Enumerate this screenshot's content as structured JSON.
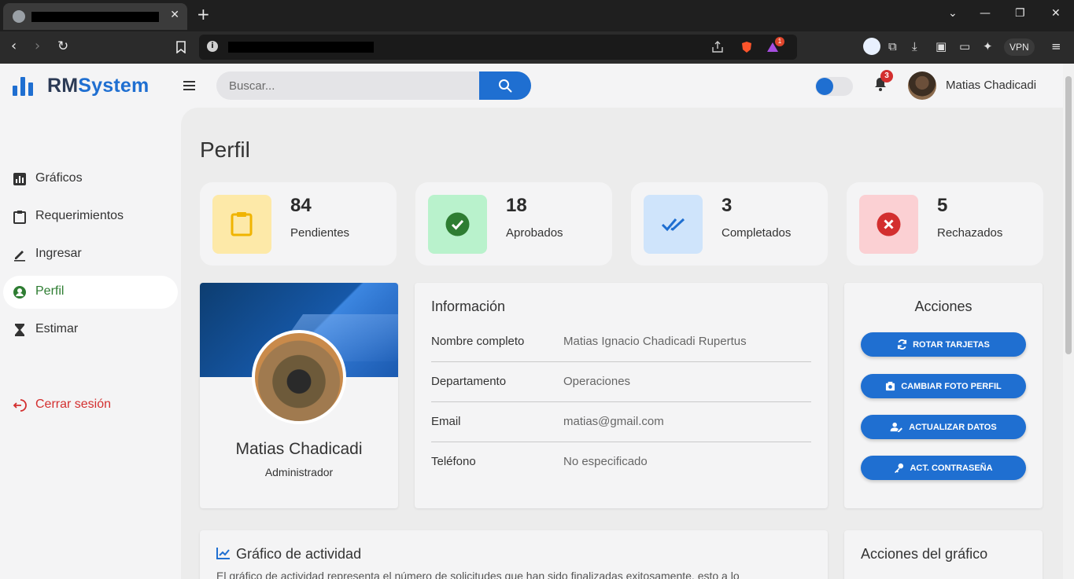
{
  "app": {
    "brand_part1": "RM",
    "brand_part2": "System",
    "search_placeholder": "Buscar...",
    "notification_count": "3",
    "user_name": "Matias Chadicadi",
    "accent_color": "#1f6fd1"
  },
  "sidebar": {
    "items": [
      {
        "label": "Gráficos",
        "icon": "bar-chart-icon"
      },
      {
        "label": "Requerimientos",
        "icon": "clipboard-icon"
      },
      {
        "label": "Ingresar",
        "icon": "pencil-icon"
      },
      {
        "label": "Perfil",
        "icon": "user-circle-icon",
        "active": true
      },
      {
        "label": "Estimar",
        "icon": "hourglass-icon"
      }
    ],
    "logout_label": "Cerrar sesión"
  },
  "page": {
    "title": "Perfil"
  },
  "stats": [
    {
      "value": "84",
      "label": "Pendientes",
      "icon": "clipboard-icon",
      "color": "#fde9a8"
    },
    {
      "value": "18",
      "label": "Aprobados",
      "icon": "check-circle-icon",
      "color": "#b9f2cc"
    },
    {
      "value": "3",
      "label": "Completados",
      "icon": "double-check-icon",
      "color": "#cfe4fb"
    },
    {
      "value": "5",
      "label": "Rechazados",
      "icon": "x-circle-icon",
      "color": "#fbd0d3"
    }
  ],
  "profile": {
    "name": "Matias Chadicadi",
    "role": "Administrador"
  },
  "info": {
    "title": "Información",
    "rows": [
      {
        "key": "Nombre completo",
        "value": "Matias Ignacio Chadicadi Rupertus"
      },
      {
        "key": "Departamento",
        "value": "Operaciones"
      },
      {
        "key": "Email",
        "value": "matias@gmail.com"
      },
      {
        "key": "Teléfono",
        "value": "No especificado"
      }
    ]
  },
  "actions": {
    "title": "Acciones",
    "buttons": [
      {
        "label": "ROTAR TARJETAS",
        "icon": "refresh-icon"
      },
      {
        "label": "CAMBIAR FOTO PERFIL",
        "icon": "camera-icon"
      },
      {
        "label": "ACTUALIZAR DATOS",
        "icon": "user-edit-icon"
      },
      {
        "label": "ACT. CONTRASEÑA",
        "icon": "key-icon"
      }
    ]
  },
  "activity": {
    "title": "Gráfico de actividad",
    "description": "El gráfico de actividad representa el número de solicitudes que han sido finalizadas exitosamente, esto a lo",
    "actions_title": "Acciones del gráfico"
  },
  "browser": {
    "vpn_label": "VPN",
    "ext_badge": "1"
  }
}
